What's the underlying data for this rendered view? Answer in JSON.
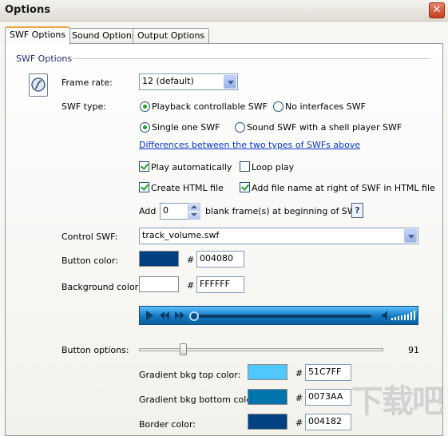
{
  "window": {
    "title": "Options",
    "close_glyph": "✕"
  },
  "tabs": [
    {
      "label": "SWF Options",
      "active": true
    },
    {
      "label": "Sound Options",
      "active": false
    },
    {
      "label": "Output Options",
      "active": false
    }
  ],
  "section": {
    "title": "SWF Options"
  },
  "frame_rate": {
    "label": "Frame rate:",
    "value": "12 (default)"
  },
  "swf_type": {
    "label": "SWF type:",
    "options": [
      {
        "label": "Playback controllable SWF",
        "selected": true
      },
      {
        "label": "No interfaces SWF",
        "selected": false
      },
      {
        "label": "Single one SWF",
        "selected": true
      },
      {
        "label": "Sound SWF with a shell player SWF",
        "selected": false
      }
    ],
    "link": "Differences between the two types of SWFs above"
  },
  "checkboxes": [
    {
      "label": "Play automatically",
      "checked": true
    },
    {
      "label": "Loop play",
      "checked": false
    },
    {
      "label": "Create HTML file",
      "checked": true
    },
    {
      "label": "Add file name at right of SWF in HTML file",
      "checked": true
    }
  ],
  "blank_frames": {
    "prefix": "Add",
    "value": "0",
    "suffix": "blank frame(s) at beginning of SWF",
    "help": "?"
  },
  "control_swf": {
    "label": "Control SWF:",
    "value": "track_volume.swf"
  },
  "button_color": {
    "label": "Button color:",
    "hash": "#",
    "hex": "004080",
    "color": "#004080"
  },
  "background_color": {
    "label": "Background color:",
    "hash": "#",
    "hex": "FFFFFF",
    "color": "#FFFFFF"
  },
  "button_options": {
    "label": "Button options:",
    "value": "91",
    "slider_fraction": 0.18
  },
  "gradient_top": {
    "label": "Gradient bkg top color:",
    "hash": "#",
    "hex": "51C7FF",
    "color": "#51C7FF"
  },
  "gradient_bottom": {
    "label": "Gradient bkg bottom color:",
    "hash": "#",
    "hex": "0073AA",
    "color": "#0073AA"
  },
  "border_color": {
    "label": "Border color:",
    "hash": "#",
    "hex": "004182",
    "color": "#004182"
  },
  "watermark": {
    "text": "下载吧"
  }
}
